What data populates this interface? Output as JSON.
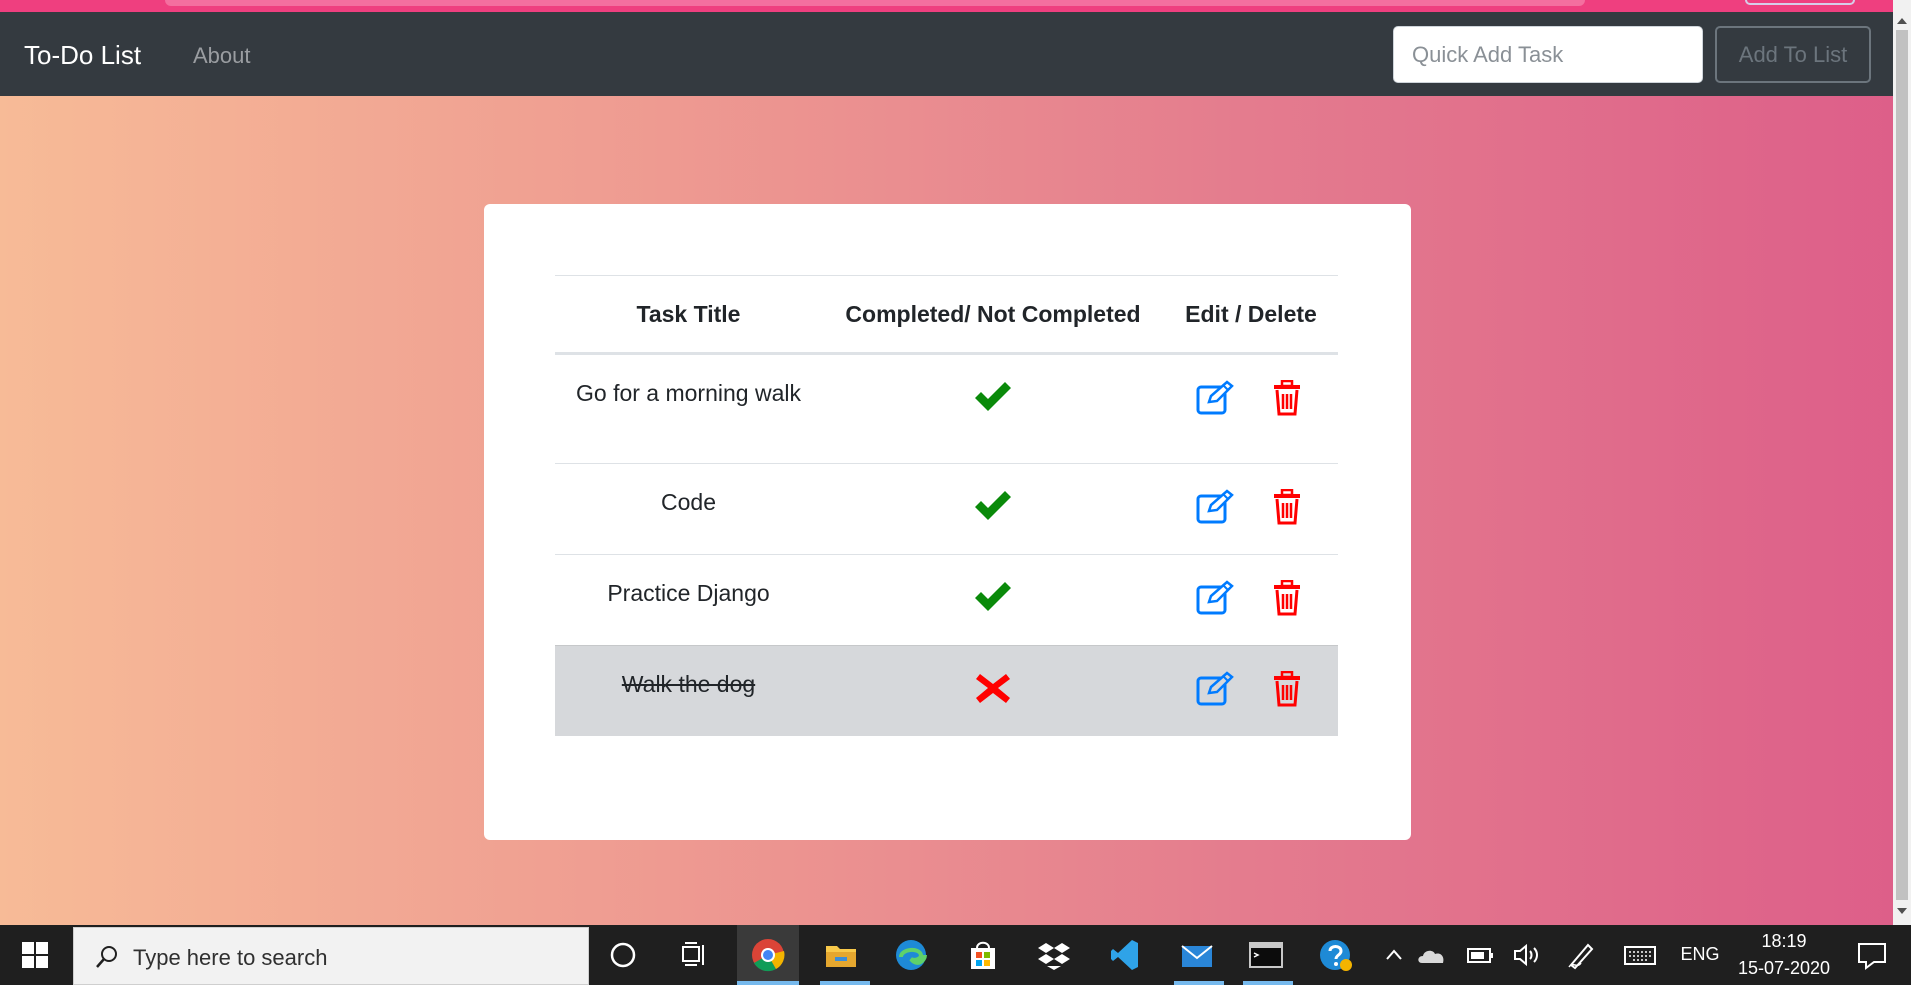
{
  "navbar": {
    "brand": "To-Do List",
    "about": "About",
    "quick_add_placeholder": "Quick Add Task",
    "add_button": "Add To List"
  },
  "table": {
    "headers": {
      "title": "Task Title",
      "status": "Completed/ Not Completed",
      "actions": "Edit / Delete"
    },
    "rows": [
      {
        "title": "Go for a morning walk",
        "completed": true
      },
      {
        "title": "Code",
        "completed": true
      },
      {
        "title": "Practice Django",
        "completed": true
      },
      {
        "title": "Walk the dog",
        "completed": false
      }
    ]
  },
  "taskbar": {
    "search_placeholder": "Type here to search",
    "language": "ENG",
    "time": "18:19",
    "date": "15-07-2020"
  },
  "colors": {
    "navbar": "#343a40",
    "check": "#0a8a0a",
    "cross": "#ff0000",
    "edit": "#007bff",
    "delete": "#ff0000",
    "strike_row": "#d6d8db"
  }
}
